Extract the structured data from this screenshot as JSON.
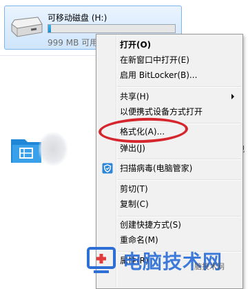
{
  "drive": {
    "name": "可移动磁盘 (H:)",
    "space_text": "999 MB 可用",
    "used_fraction": 0.02
  },
  "background": {
    "peek_text": "视"
  },
  "context_menu": {
    "items": [
      {
        "label": "打开(O)",
        "bold": true
      },
      {
        "label": "在新窗口中打开(E)"
      },
      {
        "label": "启用 BitLocker(B)..."
      },
      {
        "label": "共享(H)",
        "submenu": true
      },
      {
        "label": "以便携式设备方式打开"
      },
      {
        "label": "格式化(A)..."
      },
      {
        "label": "弹出(J)"
      },
      {
        "label": "扫描病毒(电脑管家)",
        "icon": "shield-icon"
      },
      {
        "label": "剪切(T)"
      },
      {
        "label": "复制(C)"
      },
      {
        "label": "创建快捷方式(S)"
      },
      {
        "label": "重命名(M)"
      },
      {
        "label": "属性(R)"
      }
    ]
  },
  "watermark": {
    "brand": "电脑技术网",
    "sub": "脑技术网"
  },
  "colors": {
    "highlight": "#d6262d",
    "accent": "#2e6fd6"
  }
}
